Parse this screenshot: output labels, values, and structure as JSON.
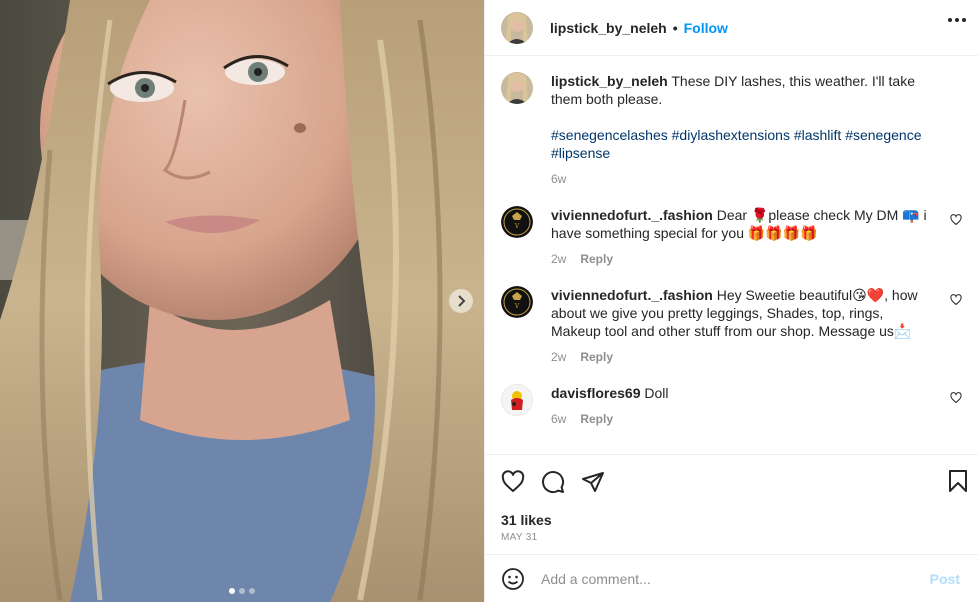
{
  "post": {
    "username": "lipstick_by_neleh",
    "separator": "•",
    "follow_label": "Follow",
    "caption": "These DIY lashes, this weather. I'll take them both please.",
    "hashtags": "#senegencelashes #diylashextensions #lashlift #senegence #lipsense",
    "caption_age": "6w",
    "likes": "31 likes",
    "date": "MAY 31"
  },
  "comments": [
    {
      "username": "viviennedofurt._.fashion",
      "text": "Dear 🌹please check My DM 📪 i have something special for you 🎁🎁🎁🎁",
      "age": "2w",
      "reply_label": "Reply"
    },
    {
      "username": "viviennedofurt._.fashion",
      "text": "Hey Sweetie beautiful😘❤️, how about we give you pretty leggings, Shades, top, rings, Makeup tool and other stuff from our shop. Message us📩",
      "age": "2w",
      "reply_label": "Reply"
    },
    {
      "username": "davisflores69",
      "text": "Doll",
      "age": "6w",
      "reply_label": "Reply"
    }
  ],
  "composer": {
    "placeholder": "Add a comment...",
    "post_label": "Post"
  },
  "icons": {
    "more": "more-horizontal-icon",
    "like": "heart-icon",
    "comment": "comment-bubble-icon",
    "share": "paper-plane-icon",
    "save": "bookmark-icon",
    "emoji": "emoji-smiley-icon",
    "next": "chevron-right-icon"
  },
  "colors": {
    "accent": "#0095f6",
    "hashtag": "#00376b",
    "muted": "#8e8e8e",
    "post_disabled": "#b2dffc"
  }
}
